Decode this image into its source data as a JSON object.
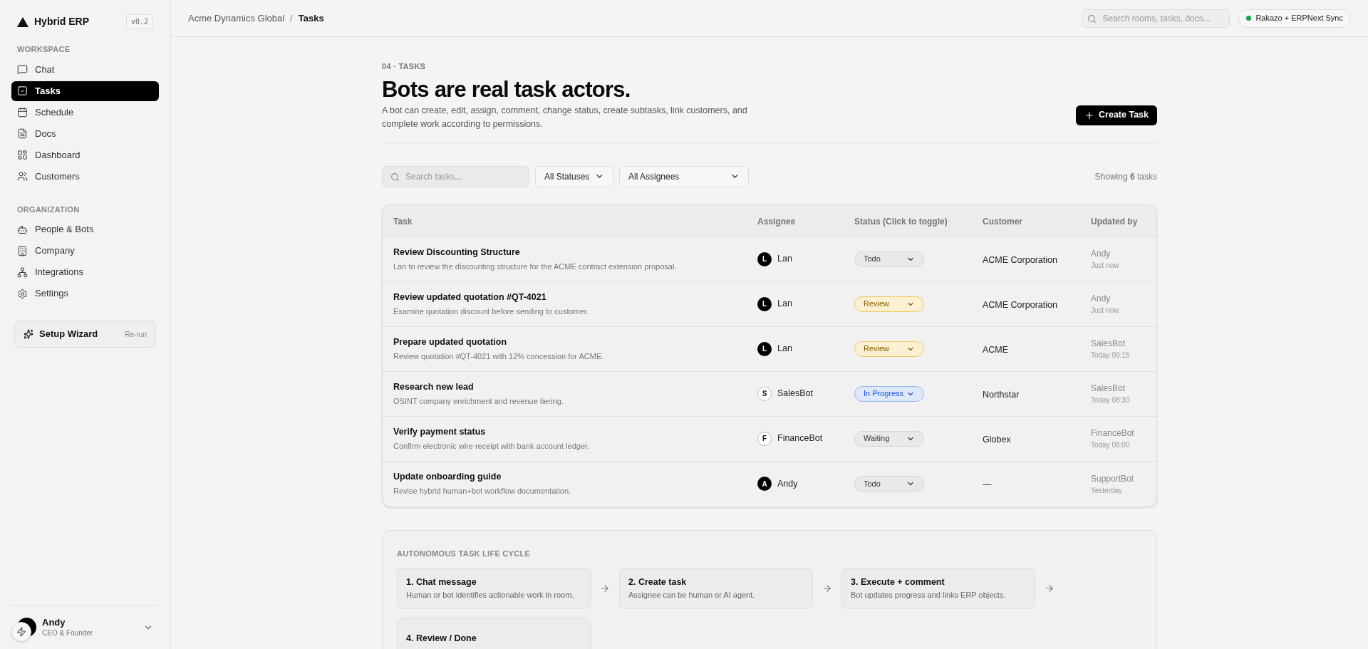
{
  "sidebar": {
    "brand": "Hybrid ERP",
    "version": "v0.2",
    "sections": [
      {
        "title": "WORKSPACE",
        "items": [
          {
            "label": "Chat",
            "selected": false
          },
          {
            "label": "Tasks",
            "selected": true
          },
          {
            "label": "Schedule",
            "selected": false
          },
          {
            "label": "Docs",
            "selected": false
          },
          {
            "label": "Dashboard",
            "selected": false
          },
          {
            "label": "Customers",
            "selected": false
          }
        ]
      },
      {
        "title": "ORGANIZATION",
        "items": [
          {
            "label": "People & Bots",
            "selected": false
          },
          {
            "label": "Company",
            "selected": false
          },
          {
            "label": "Integrations",
            "selected": false
          },
          {
            "label": "Settings",
            "selected": false
          }
        ]
      }
    ],
    "wizard": {
      "label": "Setup Wizard",
      "action": "Re-run"
    },
    "user": {
      "name": "Andy",
      "role": "CEO & Founder"
    }
  },
  "header": {
    "breadcrumb": [
      "Acme Dynamics Global",
      "Tasks"
    ],
    "breadcrumb_separator": "/",
    "search_placeholder": "Search rooms, tasks, docs...",
    "sync": "Rakazo + ERPNext Sync"
  },
  "page": {
    "eyebrow": "04 · TASKS",
    "title": "Bots are real task actors.",
    "description": "A bot can create, edit, assign, comment, change status, create subtasks, link customers, and complete work according to permissions.",
    "create_button": "Create Task"
  },
  "filters": {
    "search_placeholder": "Search tasks...",
    "status": "All Statuses",
    "assignee": "All Assignees",
    "summary": "Showing **6** tasks"
  },
  "table": {
    "columns": [
      "Task",
      "Assignee",
      "Status (Click to toggle)",
      "Customer",
      "Updated by"
    ],
    "rows": [
      {
        "title": "Review Discounting Structure",
        "description": "Lan to review the discounting structure for the ACME contract extension proposal.",
        "assignee": {
          "initial": "L",
          "name": "Lan",
          "kind": "human"
        },
        "status": {
          "label": "Todo",
          "kind": "neutral"
        },
        "customer": "ACME Corporation",
        "updated_by": "Andy",
        "updated_at": "Just now"
      },
      {
        "title": "Review updated quotation #QT-4021",
        "description": "Examine quotation discount before sending to customer.",
        "assignee": {
          "initial": "L",
          "name": "Lan",
          "kind": "human"
        },
        "status": {
          "label": "Review",
          "kind": "review"
        },
        "customer": "ACME Corporation",
        "updated_by": "Andy",
        "updated_at": "Just now"
      },
      {
        "title": "Prepare updated quotation",
        "description": "Review quotation #QT-4021 with 12% concession for ACME.",
        "assignee": {
          "initial": "L",
          "name": "Lan",
          "kind": "human"
        },
        "status": {
          "label": "Review",
          "kind": "review"
        },
        "customer": "ACME",
        "updated_by": "SalesBot",
        "updated_at": "Today 09:15"
      },
      {
        "title": "Research new lead",
        "description": "OSINT company enrichment and revenue tiering.",
        "assignee": {
          "initial": "S",
          "name": "SalesBot",
          "kind": "bot"
        },
        "status": {
          "label": "In Progress",
          "kind": "progress"
        },
        "customer": "Northstar",
        "updated_by": "SalesBot",
        "updated_at": "Today 08:30"
      },
      {
        "title": "Verify payment status",
        "description": "Confirm electronic wire receipt with bank account ledger.",
        "assignee": {
          "initial": "F",
          "name": "FinanceBot",
          "kind": "bot"
        },
        "status": {
          "label": "Waiting",
          "kind": "neutral"
        },
        "customer": "Globex",
        "updated_by": "FinanceBot",
        "updated_at": "Today 08:00"
      },
      {
        "title": "Update onboarding guide",
        "description": "Revise hybrid human+bot workflow documentation.",
        "assignee": {
          "initial": "A",
          "name": "Andy",
          "kind": "human"
        },
        "status": {
          "label": "Todo",
          "kind": "neutral"
        },
        "customer": "—",
        "updated_by": "SupportBot",
        "updated_at": "Yesterday"
      }
    ]
  },
  "lifecycle": {
    "title": "AUTONOMOUS TASK LIFE CYCLE",
    "steps": [
      {
        "title": "1. Chat message",
        "description": "Human or bot identifies actionable work in room."
      },
      {
        "title": "2. Create task",
        "description": "Assignee can be human or AI agent."
      },
      {
        "title": "3. Execute + comment",
        "description": "Bot updates progress and links ERP objects."
      },
      {
        "title": "4. Review / Done"
      }
    ]
  }
}
